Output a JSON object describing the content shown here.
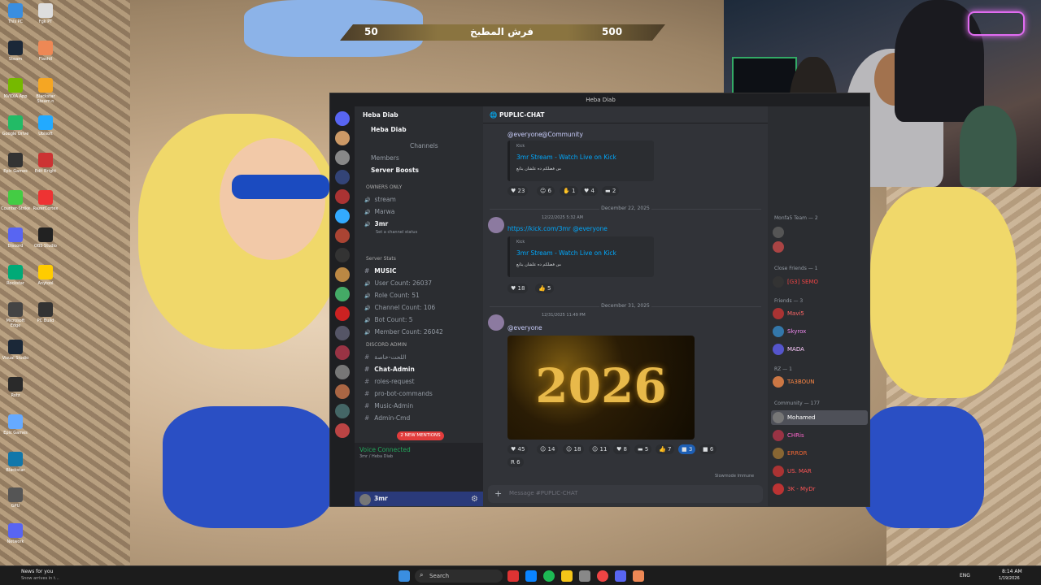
{
  "overlay": {
    "score_left": "50",
    "score_title": "فرش المطبخ",
    "score_right": "500"
  },
  "desktop_icons": [
    "This PC",
    "Fgk PT",
    "Steam",
    "Flashtl",
    "NVIDIA App",
    "Blackstar Steam.n",
    "Google Drive",
    "Ubisoft",
    "Epic Games",
    "Edit Bright",
    "Counter-Strike",
    "RazerCortex",
    "Discord",
    "OBS Studio",
    "Rockstar",
    "Anytool",
    "Microsoft Edge",
    "PC Build",
    "Visual Studio",
    "Rotz",
    "Epic Games",
    "Blackstar",
    "GPU",
    "Network"
  ],
  "discord": {
    "window_title": "Heba Diab",
    "server_name": "Heba Diab",
    "channel_header": "PUPLIC-CHAT",
    "sidebar": {
      "server_label": "Heba Diab",
      "browse": "Channels",
      "members": "Members",
      "boosts": "Server Boosts",
      "owners_category": "OWNERS ONLY",
      "voice1": "stream",
      "voice2": "Marwa",
      "user_name": "3mr",
      "user_status": "Set a channel status",
      "stats_category": "Server Stats",
      "music": "MUSIC",
      "stats": [
        "User Count: 26037",
        "Role Count: 51",
        "Channel Count: 106",
        "Bot Count: 5",
        "Member Count: 26042"
      ],
      "admin_category": "DISCORD ADMIN",
      "admin_sub": "اللحت-خاصة",
      "admin_channels": [
        "Chat-Admin",
        "roles-request",
        "pro-bot-commands",
        "Music-Admin",
        "Admin-Cmd"
      ],
      "mentions_pill": "2 NEW MENTIONS",
      "voice_connected": "Voice Connected",
      "voice_sub": "3mr / Heba Diab",
      "bottom_user": "3mr"
    },
    "messages": [
      {
        "link_a": "@everyone",
        "link_b": "@Community",
        "embed_provider": "Kick",
        "embed_title": "3mr Stream - Watch Live on Kick",
        "embed_desc": "من فضلكم ده علشان يتابع",
        "reactions": [
          "23",
          "6",
          "1",
          "4",
          "2"
        ]
      },
      {
        "date": "December 22, 2025",
        "time": "12/22/2025 5:32 AM",
        "text": "https://kick.com/3mr @everyone",
        "embed_provider": "Kick",
        "embed_title": "3mr Stream - Watch Live on Kick",
        "embed_desc": "من فضلكم ده علشان يتابع",
        "reactions": [
          "18",
          "5"
        ]
      },
      {
        "date": "December 31, 2025",
        "time": "12/31/2025 11:49 PM",
        "text": "@everyone",
        "image_text": "2026",
        "reactions": [
          "45",
          "14",
          "18",
          "11",
          "8",
          "5",
          "7",
          "3",
          "6",
          "6"
        ]
      }
    ],
    "slowmode": "Slowmode Immune",
    "message_placeholder": "Message #PUPLIC-CHAT",
    "members": {
      "groups": [
        {
          "title": "Monfa5 Team — 2",
          "names": [
            "",
            "",
            ""
          ]
        },
        {
          "title": "Close Friends — 1",
          "names": [
            "[G3] SEMO"
          ]
        },
        {
          "title": "Friends — 3",
          "names": [
            "Mavi5",
            "Skyrox",
            "MADA"
          ]
        },
        {
          "title": "RZ — 1",
          "names": [
            "TA3BOUN"
          ]
        },
        {
          "title": "Community — 177",
          "names": [
            "Mohamed",
            "CHRis",
            "ERROR",
            "US. MAR",
            "3K - MyDr",
            ""
          ]
        }
      ]
    }
  },
  "taskbar": {
    "search": "Search",
    "news_title": "News for you",
    "news_sub": "Snow arrives in t...",
    "lang": "ENG",
    "time": "8:14 AM",
    "date": "1/19/2026"
  }
}
